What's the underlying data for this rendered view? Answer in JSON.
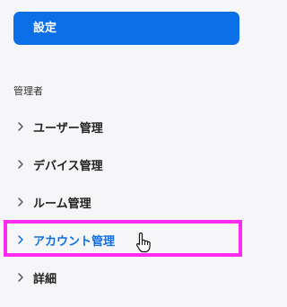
{
  "sidebar": {
    "settings_label": "設定",
    "section_label": "管理者",
    "items": [
      {
        "label": "ユーザー管理",
        "active": false
      },
      {
        "label": "デバイス管理",
        "active": false
      },
      {
        "label": "ルーム管理",
        "active": false
      },
      {
        "label": "アカウント管理",
        "active": true
      },
      {
        "label": "詳細",
        "active": false
      }
    ]
  },
  "icons": {
    "chevron": "chevron-right-icon",
    "cursor": "hand-pointer-icon"
  },
  "colors": {
    "accent": "#0b6fe8",
    "highlight": "#ff2bf0",
    "background": "#f6f6f9"
  }
}
